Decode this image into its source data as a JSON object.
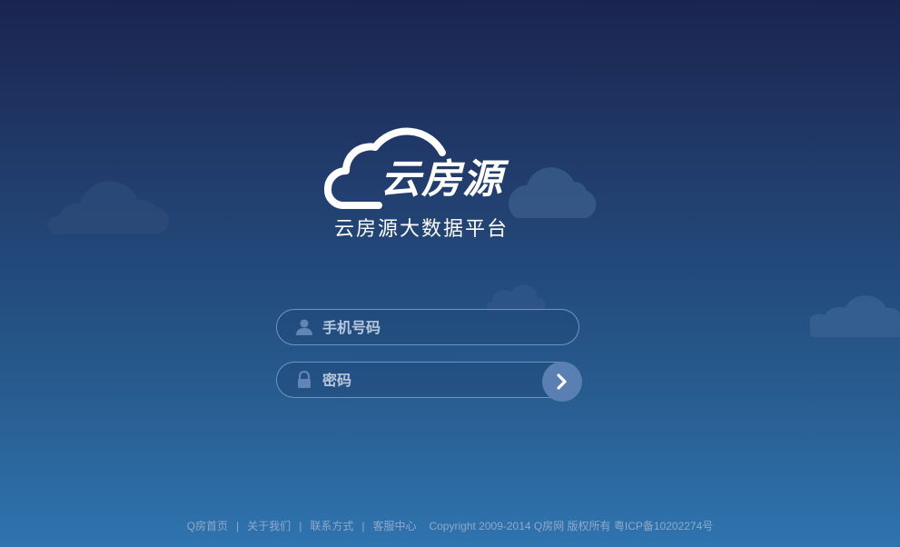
{
  "brand": {
    "logo_text": "云房源",
    "subtitle": "云房源大数据平台"
  },
  "form": {
    "phone_placeholder": "手机号码",
    "password_placeholder": "密码",
    "phone_icon": "user-icon",
    "password_icon": "lock-icon",
    "submit_icon": "chevron-right-icon"
  },
  "footer": {
    "links": [
      "Q房首页",
      "关于我们",
      "联系方式",
      "客服中心"
    ],
    "separator": "|",
    "copyright": "Copyright 2009-2014  Q房网  版权所有  粤ICP备10202274号"
  },
  "colors": {
    "background_top": "#1a2450",
    "background_bottom": "#2f74b0",
    "submit_button": "#5a7fb3"
  }
}
